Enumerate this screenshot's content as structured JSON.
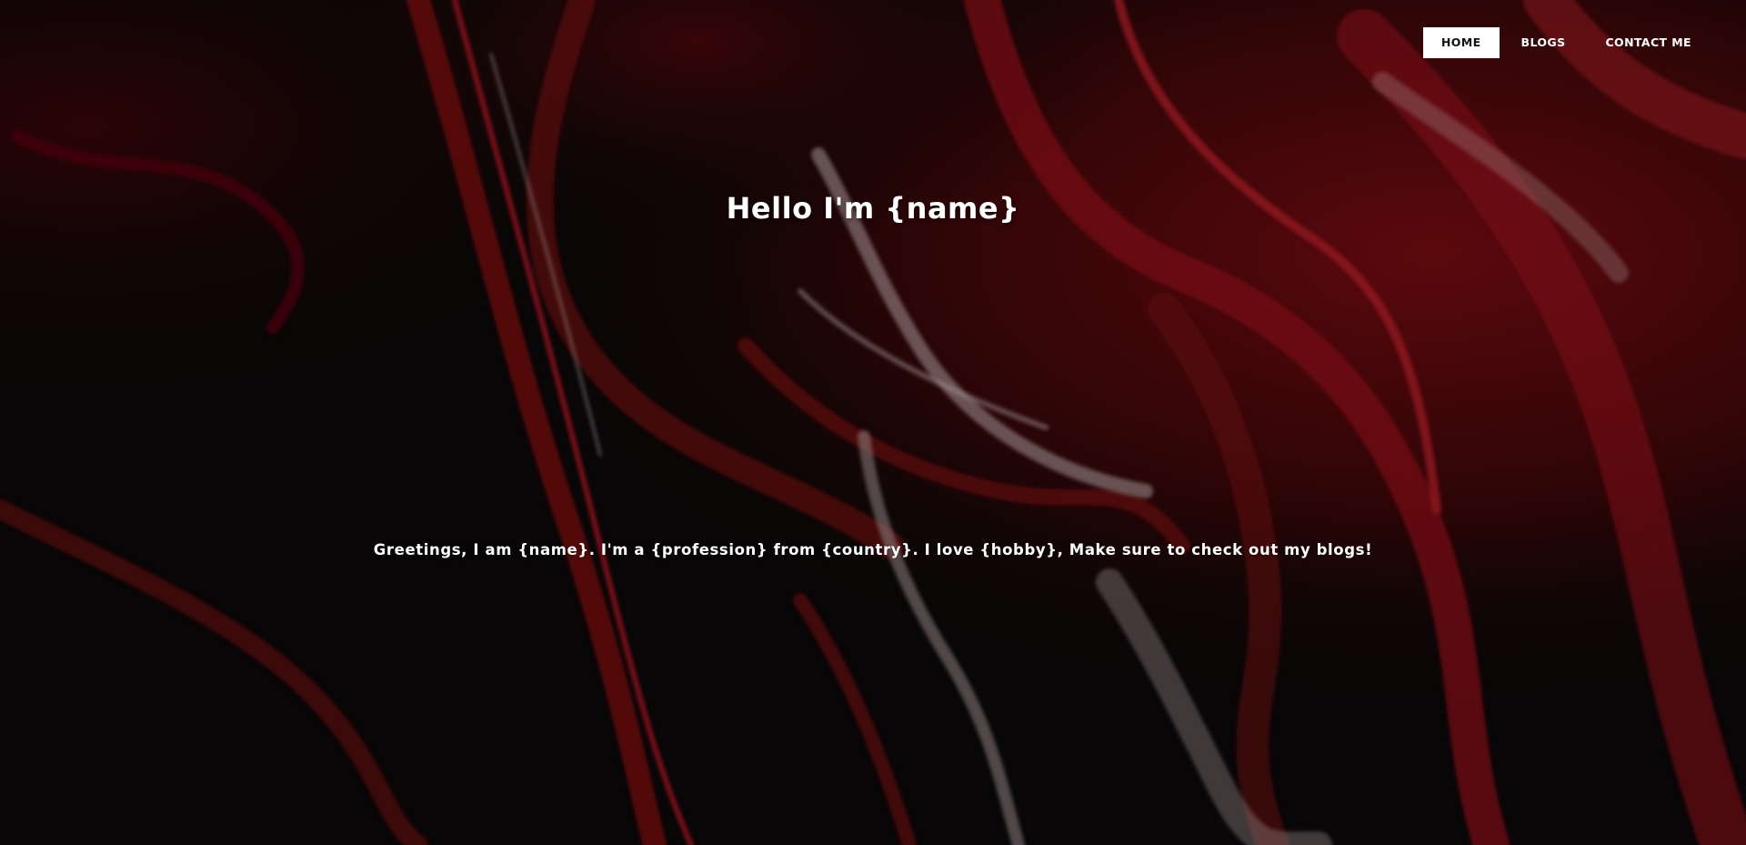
{
  "nav": {
    "items": [
      {
        "label": "HOME",
        "active": true
      },
      {
        "label": "BLOGS",
        "active": false
      },
      {
        "label": "CONTACT ME",
        "active": false
      }
    ]
  },
  "hero": {
    "title": "Hello I'm {name}",
    "intro": "Greetings, I am {name}. I'm a {profession} from {country}. I love {hobby}, Make sure to check out my blogs!"
  },
  "colors": {
    "background": "#0b0809",
    "accent_red": "#8c0f16",
    "text": "#ffffff"
  }
}
